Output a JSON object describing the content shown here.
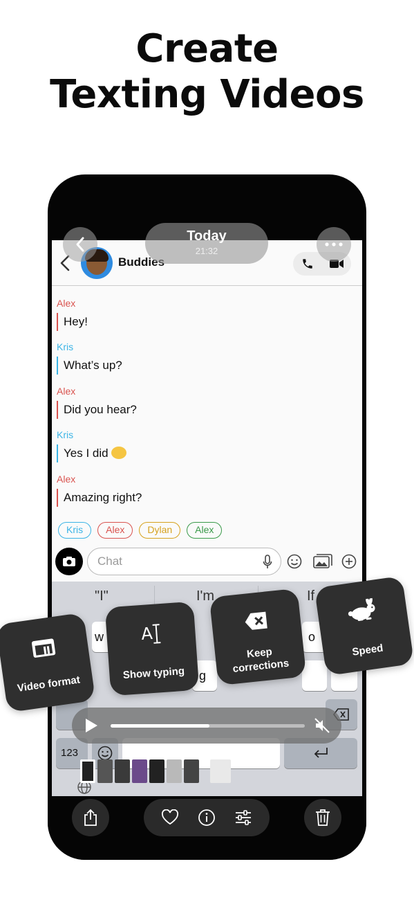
{
  "headline": {
    "line1": "Create",
    "line2": "Texting Videos"
  },
  "overlay": {
    "date": "Today",
    "time": "21:32"
  },
  "chat": {
    "name": "Buddies",
    "messages": [
      {
        "sender": "Alex",
        "text": "Hey!",
        "color": "#d9534f"
      },
      {
        "sender": "Kris",
        "text": "What’s up?",
        "color": "#3cb4e6"
      },
      {
        "sender": "Alex",
        "text": "Did you hear?",
        "color": "#d9534f"
      },
      {
        "sender": "Kris",
        "text": "Yes I did",
        "color": "#3cb4e6"
      },
      {
        "sender": "Alex",
        "text": "Amazing right?",
        "color": "#d9534f"
      }
    ],
    "chips": [
      {
        "label": "Kris",
        "color": "#3cb4e6"
      },
      {
        "label": "Alex",
        "color": "#d9534f"
      },
      {
        "label": "Dylan",
        "color": "#d6a21e"
      },
      {
        "label": "Alex",
        "color": "#3a9a4a"
      }
    ],
    "input_placeholder": "Chat"
  },
  "keyboard": {
    "suggestions": [
      "\"I\"",
      "I'm",
      "If"
    ],
    "visible_keys": [
      "w",
      "o",
      "g"
    ],
    "num_key": "123"
  },
  "playback": {
    "progress": 0.51
  },
  "cards": {
    "video_format": "Video format",
    "show_typing": "Show typing",
    "keep_corrections_1": "Keep",
    "keep_corrections_2": "corrections",
    "speed": "Speed",
    "show_typing_icon_text": "A"
  },
  "colors": {
    "accent_dark": "#2f2f2f",
    "phone_frame": "#050505"
  }
}
